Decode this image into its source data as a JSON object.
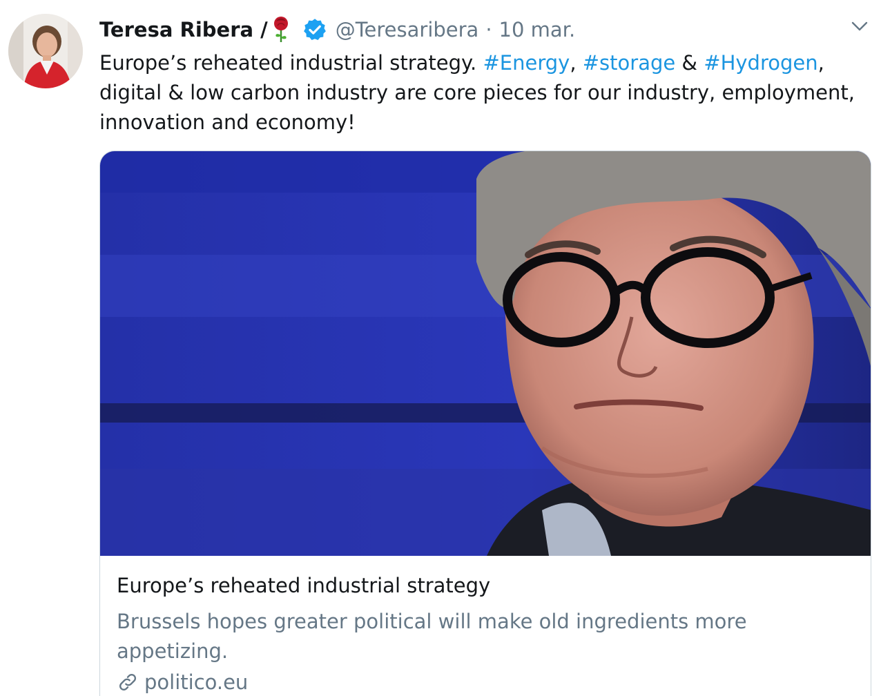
{
  "user": {
    "display_name": "Teresa Ribera /",
    "emoji": "rose-icon",
    "verified": true,
    "handle": "@Teresaribera",
    "separator": "·",
    "timestamp": "10 mar."
  },
  "tweet": {
    "text_part1": "Europe’s reheated industrial strategy. ",
    "hashtag1": "#Energy",
    "text_part2": ", ",
    "hashtag2": "#storage",
    "text_part3": " & ",
    "hashtag3": "#Hydrogen",
    "text_part4": ", digital & low carbon industry are core pieces for our industry, employment, innovation and economy!"
  },
  "card": {
    "title": "Europe’s reheated industrial strategy",
    "description": "Brussels hopes greater political will make old ingredients more appetizing.",
    "domain": "politico.eu"
  },
  "colors": {
    "hashtag": "#1b95e0",
    "secondary_text": "#657786",
    "verified_badge": "#1da1f2",
    "border": "#ccd6dd"
  }
}
